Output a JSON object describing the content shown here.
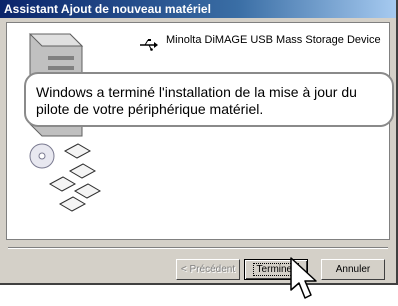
{
  "window": {
    "title": "Assistant Ajout de nouveau matériel"
  },
  "device": {
    "name": "Minolta DiMAGE  USB Mass Storage Device",
    "icon": "usb-icon"
  },
  "message": "Windows a terminé l'installation de la mise à jour du pilote de votre périphérique matériel.",
  "buttons": {
    "back": "< Précédent",
    "finish": "Terminer",
    "cancel": "Annuler"
  },
  "colors": {
    "titlebar_start": "#0a246a",
    "titlebar_end": "#a6caf0",
    "face": "#d4d0c8"
  }
}
